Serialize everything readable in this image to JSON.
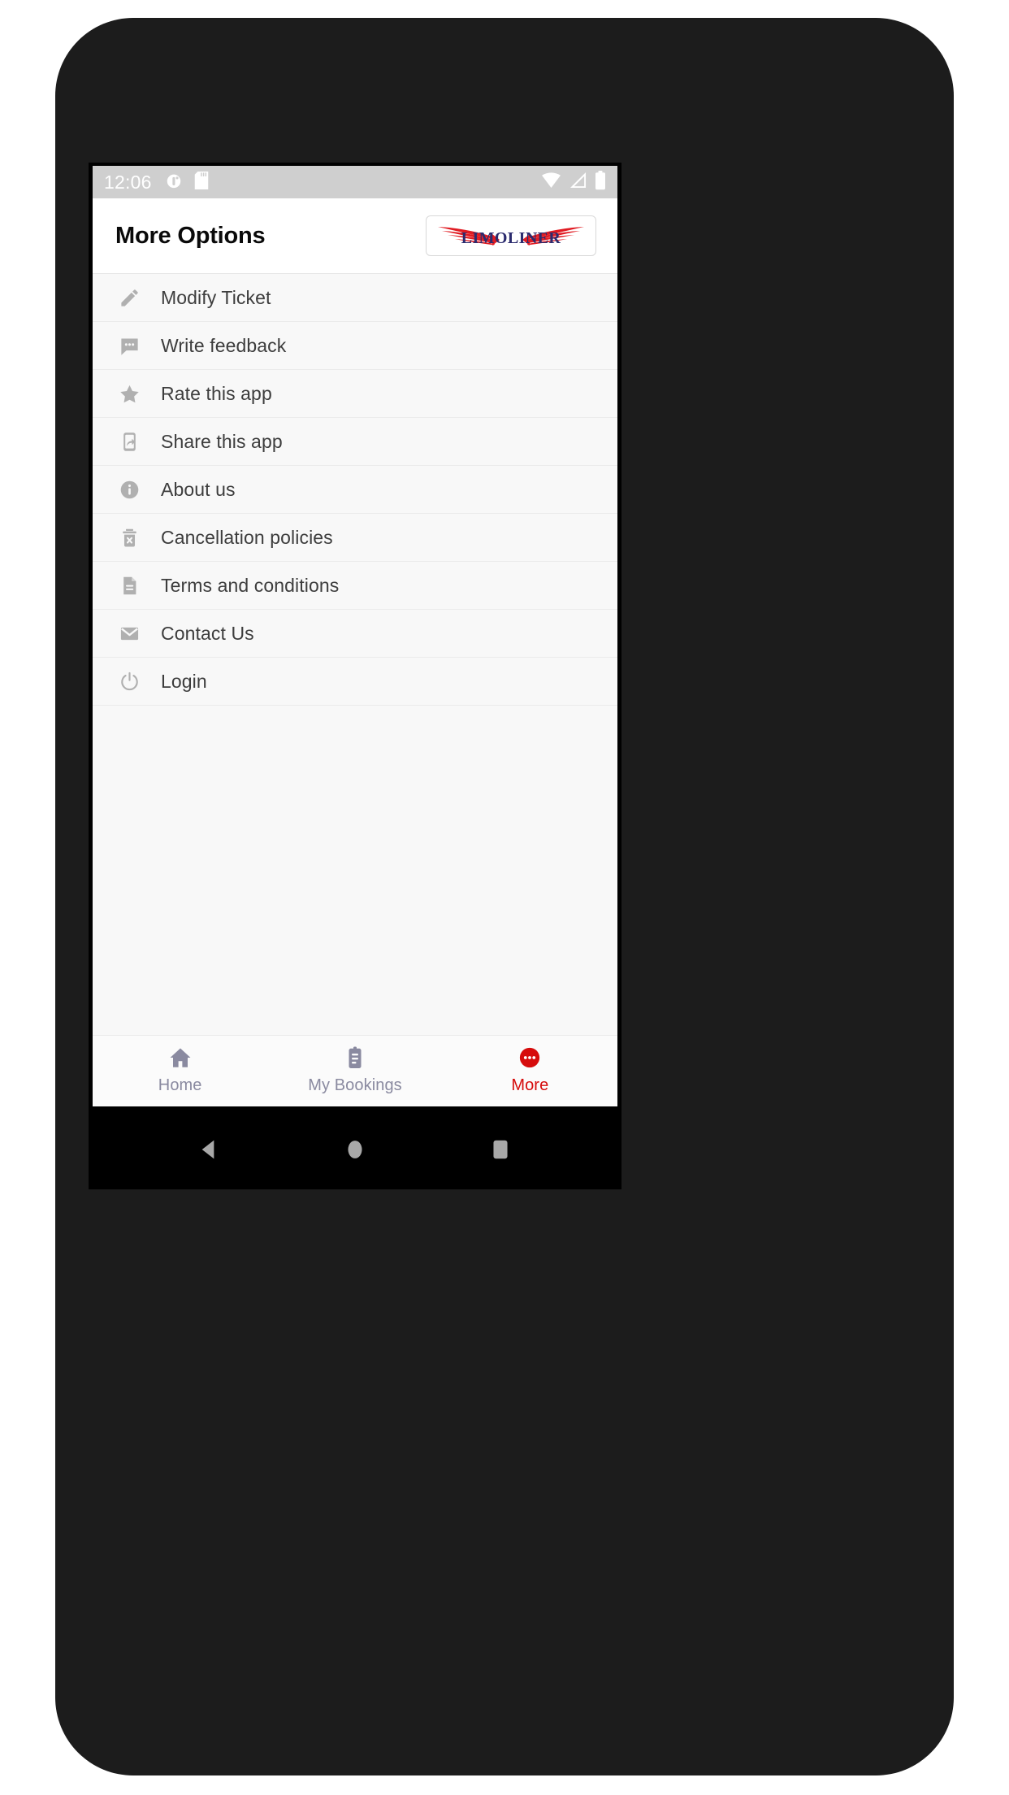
{
  "status_bar": {
    "time": "12:06",
    "left_icons": [
      "alarm-clock-icon",
      "sd-card-icon"
    ],
    "right_icons": [
      "wifi-icon",
      "cellular-signal-icon",
      "battery-icon"
    ]
  },
  "header": {
    "title": "More Options",
    "logo_text": "LIMOLINER",
    "logo_text_color": "#2b2b6e",
    "logo_wing_color": "#e01b22"
  },
  "menu": {
    "items": [
      {
        "label": "Modify Ticket",
        "icon": "pencil-icon"
      },
      {
        "label": "Write feedback",
        "icon": "comment-dots-icon"
      },
      {
        "label": "Rate this app",
        "icon": "star-icon"
      },
      {
        "label": "Share this app",
        "icon": "phone-share-icon"
      },
      {
        "label": "About us",
        "icon": "info-circle-icon"
      },
      {
        "label": "Cancellation policies",
        "icon": "trash-x-icon"
      },
      {
        "label": "Terms and conditions",
        "icon": "document-icon"
      },
      {
        "label": "Contact Us",
        "icon": "envelope-icon"
      },
      {
        "label": "Login",
        "icon": "power-icon"
      }
    ]
  },
  "bottom_nav": {
    "active_color": "#d60c0c",
    "inactive_color": "#8a8aa0",
    "items": [
      {
        "label": "Home",
        "icon": "home-icon",
        "active": false
      },
      {
        "label": "My Bookings",
        "icon": "clipboard-icon",
        "active": false
      },
      {
        "label": "More",
        "icon": "more-dots-icon",
        "active": true
      }
    ]
  },
  "android_nav": {
    "buttons": [
      "back-button",
      "home-button",
      "recents-button"
    ]
  }
}
